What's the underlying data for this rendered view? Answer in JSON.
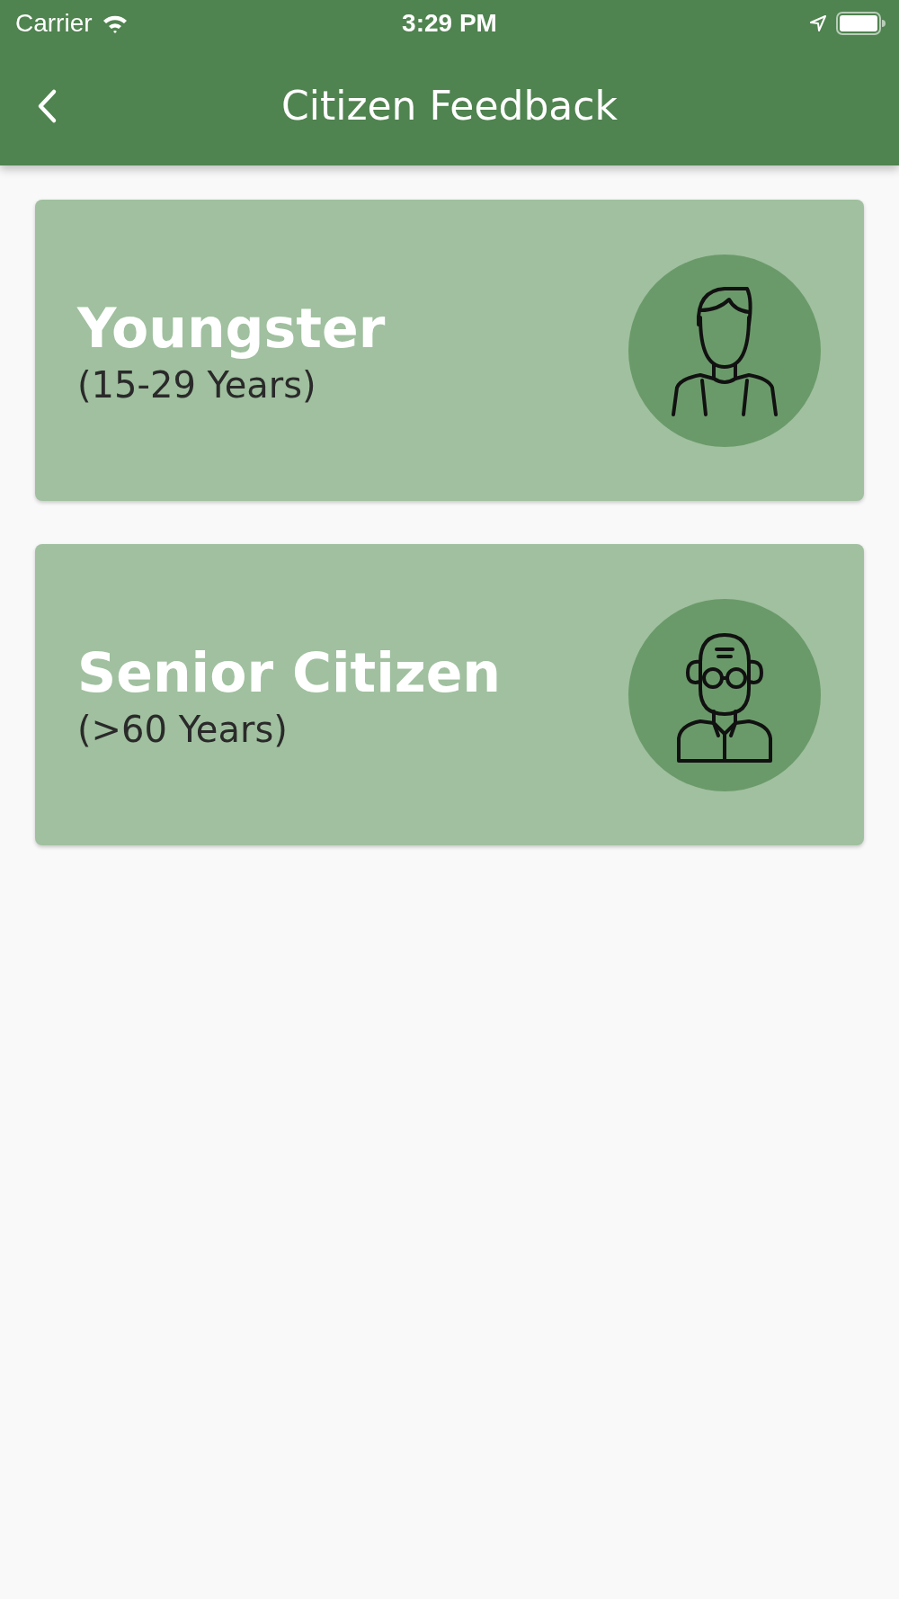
{
  "status_bar": {
    "carrier": "Carrier",
    "time": "3:29 PM"
  },
  "app_bar": {
    "title": "Citizen Feedback"
  },
  "cards": [
    {
      "title": "Youngster",
      "subtitle": "(15-29 Years)",
      "kind": "young"
    },
    {
      "title": "Senior Citizen",
      "subtitle": "(>60 Years)",
      "kind": "senior"
    }
  ]
}
